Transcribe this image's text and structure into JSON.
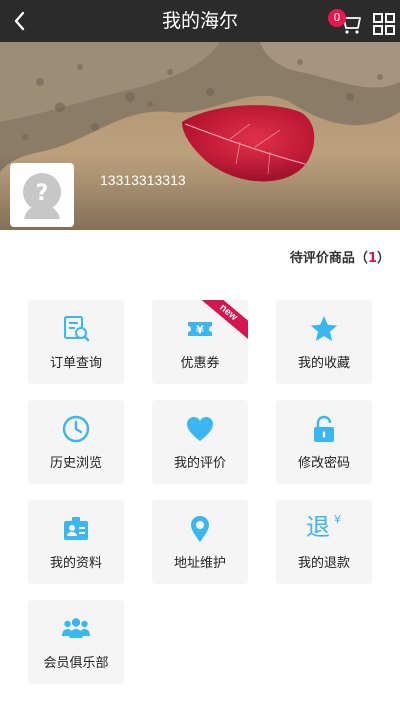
{
  "header": {
    "title": "我的海尔",
    "cart_count": "0"
  },
  "user": {
    "phone": "13313313313"
  },
  "pending_review": {
    "label": "待评价商品",
    "open": "（",
    "count": "1",
    "close": "）"
  },
  "tiles": [
    {
      "label": "订单查询",
      "icon": "order-search-icon"
    },
    {
      "label": "优惠券",
      "icon": "coupon-icon",
      "badge": "new"
    },
    {
      "label": "我的收藏",
      "icon": "star-icon"
    },
    {
      "label": "历史浏览",
      "icon": "clock-icon"
    },
    {
      "label": "我的评价",
      "icon": "heart-icon"
    },
    {
      "label": "修改密码",
      "icon": "lock-icon"
    },
    {
      "label": "我的资料",
      "icon": "profile-card-icon"
    },
    {
      "label": "地址维护",
      "icon": "location-pin-icon"
    },
    {
      "label": "我的退款",
      "icon": "refund-icon",
      "icon_text": "退",
      "icon_sup": "¥"
    },
    {
      "label": "会员俱乐部",
      "icon": "members-icon"
    }
  ],
  "colors": {
    "header_bg": "#2b2b2b",
    "accent_blue": "#3ab6f0",
    "accent_red": "#d6154d",
    "tile_bg": "#f5f5f5"
  }
}
